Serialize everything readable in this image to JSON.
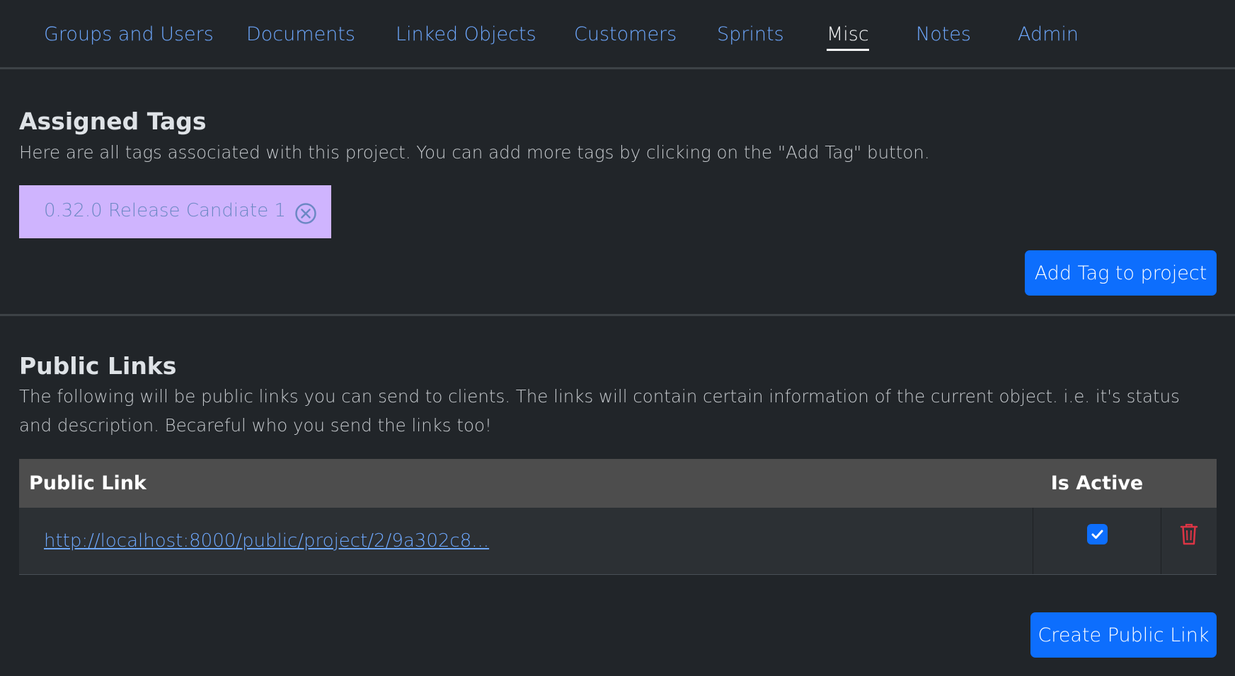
{
  "tabs": [
    {
      "label": "Groups and Users"
    },
    {
      "label": "Documents"
    },
    {
      "label": "Linked Objects"
    },
    {
      "label": "Customers"
    },
    {
      "label": "Sprints"
    },
    {
      "label": "Misc",
      "active": true
    },
    {
      "label": "Notes"
    },
    {
      "label": "Admin"
    }
  ],
  "tags_section": {
    "title": "Assigned Tags",
    "description": "Here are all tags associated with this project. You can add more tags by clicking on the \"Add Tag\" button.",
    "tags": [
      {
        "label": "0.32.0 Release Candiate 1",
        "color": "#cfb4fe"
      }
    ],
    "add_button": "Add Tag to project"
  },
  "links_section": {
    "title": "Public Links",
    "description": "The following will be public links you can send to clients. The links will contain certain information of the current object. i.e. it's status and description. Becareful who you send the links too!",
    "columns": [
      "Public Link",
      "Is Active"
    ],
    "rows": [
      {
        "link": "http://localhost:8000/public/project/2/9a302c8...",
        "is_active": true
      }
    ],
    "create_button": "Create Public Link"
  },
  "colors": {
    "background": "#212529",
    "accent": "#0d6efd",
    "link": "#6ea8fe",
    "delete": "#dc3545"
  }
}
